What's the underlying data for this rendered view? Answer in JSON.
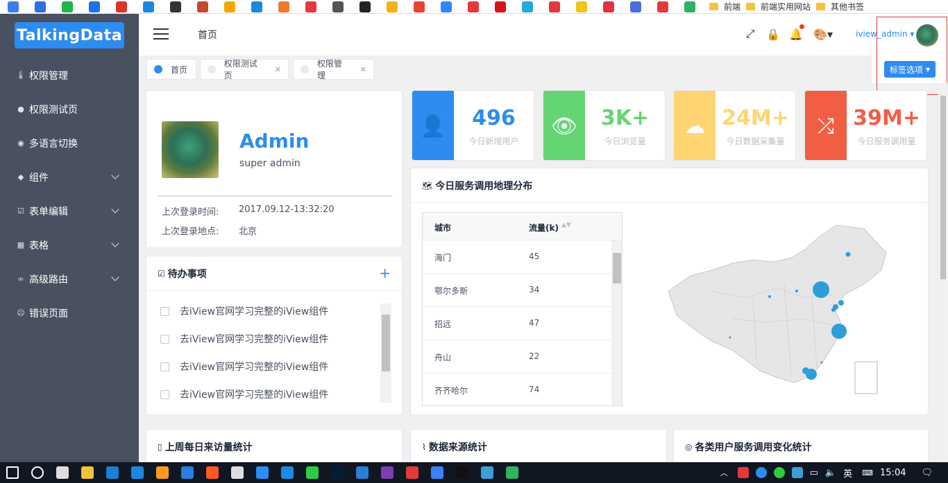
{
  "bookmarks": {
    "icon_colors": [
      "#3b7ded",
      "#2f6fe4",
      "#21b24b",
      "#1a73e8",
      "#d9332c",
      "#1d86e0",
      "#333333",
      "#c24b2a",
      "#f2a700",
      "#1a8bd6",
      "#f07b2e",
      "#e4393c",
      "#555555",
      "#222222",
      "#f7b01a",
      "#e94335",
      "#2f88ff",
      "#e4393c",
      "#d4151e",
      "#22a9e0",
      "#e4393c",
      "#f0c419",
      "#e0353d",
      "#4a6ee0",
      "#e4393c",
      "#2fb262"
    ],
    "folders": [
      "前端",
      "前端实用网站",
      "其他书签"
    ]
  },
  "sidebar": {
    "logo": "TalkingData",
    "items": [
      {
        "label": "权限管理",
        "icon": "🌡",
        "expandable": false
      },
      {
        "label": "权限测试页",
        "icon": "●",
        "expandable": false
      },
      {
        "label": "多语言切换",
        "icon": "◉",
        "expandable": false
      },
      {
        "label": "组件",
        "icon": "◆",
        "expandable": true
      },
      {
        "label": "表单编辑",
        "icon": "☑",
        "expandable": true
      },
      {
        "label": "表格",
        "icon": "▦",
        "expandable": true
      },
      {
        "label": "高级路由",
        "icon": "∞",
        "expandable": true
      },
      {
        "label": "错误页面",
        "icon": "☹",
        "expandable": false
      }
    ]
  },
  "header": {
    "breadcrumb": "首页",
    "username": "iview_admin ▾",
    "fullscreen_icon": "⤢",
    "lock_icon": "🔒",
    "bell_icon": "🔔",
    "theme_icon": "🎨▾"
  },
  "tags": {
    "items": [
      {
        "label": "首页",
        "active": true,
        "closable": false
      },
      {
        "label": "权限测试页",
        "active": false,
        "closable": true
      },
      {
        "label": "权限管理",
        "active": false,
        "closable": true
      }
    ],
    "options_label": "标签选项",
    "close_glyph": "✕"
  },
  "profile": {
    "name": "Admin",
    "role": "super admin",
    "last_login_time_label": "上次登录时间:",
    "last_login_time": "2017.09.12-13:32:20",
    "last_login_place_label": "上次登录地点:",
    "last_login_place": "北京"
  },
  "todo": {
    "title": "待办事项",
    "add_glyph": "+",
    "items": [
      "去iView官网学习完整的iView组件",
      "去iView官网学习完整的iView组件",
      "去iView官网学习完整的iView组件",
      "去iView官网学习完整的iView组件"
    ]
  },
  "stats": [
    {
      "value": "496",
      "label": "今日新增用户",
      "color": "#2d8cf0",
      "icon": "👤"
    },
    {
      "value": "3K+",
      "label": "今日浏览量",
      "color": "#64d572",
      "icon": "👁"
    },
    {
      "value": "24M+",
      "label": "今日数据采集量",
      "color": "#ffd572",
      "icon": "☁"
    },
    {
      "value": "39M+",
      "label": "今日服务调用量",
      "color": "#f25e43",
      "icon": "⤮"
    }
  ],
  "geo": {
    "title": "今日服务调用地理分布",
    "table": {
      "col_city": "城市",
      "col_flow": "流量(k)",
      "rows": [
        [
          "海门",
          "45"
        ],
        [
          "鄂尔多斯",
          "34"
        ],
        [
          "招远",
          "47"
        ],
        [
          "舟山",
          "22"
        ],
        [
          "齐齐哈尔",
          "74"
        ]
      ]
    }
  },
  "bottom_cards": [
    {
      "title": "上周每日来访量统计",
      "icon": "▯"
    },
    {
      "title": "数据来源统计",
      "icon": "⌇"
    },
    {
      "title": "各类用户服务调用变化统计",
      "icon": "◎"
    }
  ],
  "taskbar": {
    "icon_colors": [
      "#ffffff",
      "#ff7a00",
      "#dddddd",
      "#f3c13a",
      "#1b7fd6",
      "#1b88e0",
      "#ff9b1c",
      "#2a7fe0",
      "#ff5a1f",
      "#dddddd",
      "#2b8ef0",
      "#1e88e5",
      "#2ecc40",
      "#001e36",
      "#2a7fd4",
      "#7b3fb5",
      "#e4393c",
      "#3b82f6",
      "#111111",
      "#3d9fd8",
      "#2fb262"
    ],
    "ime": "英",
    "time": "15:04"
  }
}
